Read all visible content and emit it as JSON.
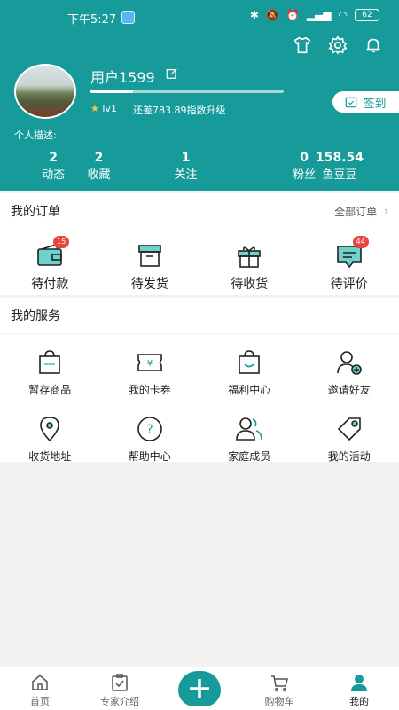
{
  "status": {
    "time": "下午5:27",
    "battery": "62"
  },
  "profile": {
    "username": "用户1599",
    "level": "lv1",
    "upgrade_text": "还差783.89指数升级",
    "progress": 0.22,
    "sign_label": "签到",
    "desc_label": "个人描述:"
  },
  "stats": [
    {
      "num": "2",
      "label": "动态"
    },
    {
      "num": "2",
      "label": "收藏"
    },
    {
      "num": "1",
      "label": "关注"
    },
    {
      "num": "0",
      "label": "粉丝"
    },
    {
      "num": "158.54",
      "label": "鱼豆豆"
    }
  ],
  "orders": {
    "title": "我的订单",
    "all_label": "全部订单",
    "items": [
      {
        "label": "待付款",
        "badge": "15"
      },
      {
        "label": "待发货",
        "badge": ""
      },
      {
        "label": "待收货",
        "badge": ""
      },
      {
        "label": "待评价",
        "badge": "44"
      }
    ]
  },
  "services": {
    "title": "我的服务",
    "row1": [
      {
        "label": "暂存商品",
        "icon": "bag-icon"
      },
      {
        "label": "我的卡券",
        "icon": "coupon-icon"
      },
      {
        "label": "福利中心",
        "icon": "gift-bag-icon"
      },
      {
        "label": "邀请好友",
        "icon": "add-user-icon"
      }
    ],
    "row2": [
      {
        "label": "收货地址",
        "icon": "location-icon"
      },
      {
        "label": "帮助中心",
        "icon": "help-icon"
      },
      {
        "label": "家庭成员",
        "icon": "family-icon"
      },
      {
        "label": "我的活动",
        "icon": "tag-icon"
      }
    ]
  },
  "tabs": [
    {
      "label": "首页"
    },
    {
      "label": "专家介绍"
    },
    {
      "label": ""
    },
    {
      "label": "购物车"
    },
    {
      "label": "我的"
    }
  ],
  "colors": {
    "accent": "#179a9a",
    "badge": "#e8453c"
  }
}
